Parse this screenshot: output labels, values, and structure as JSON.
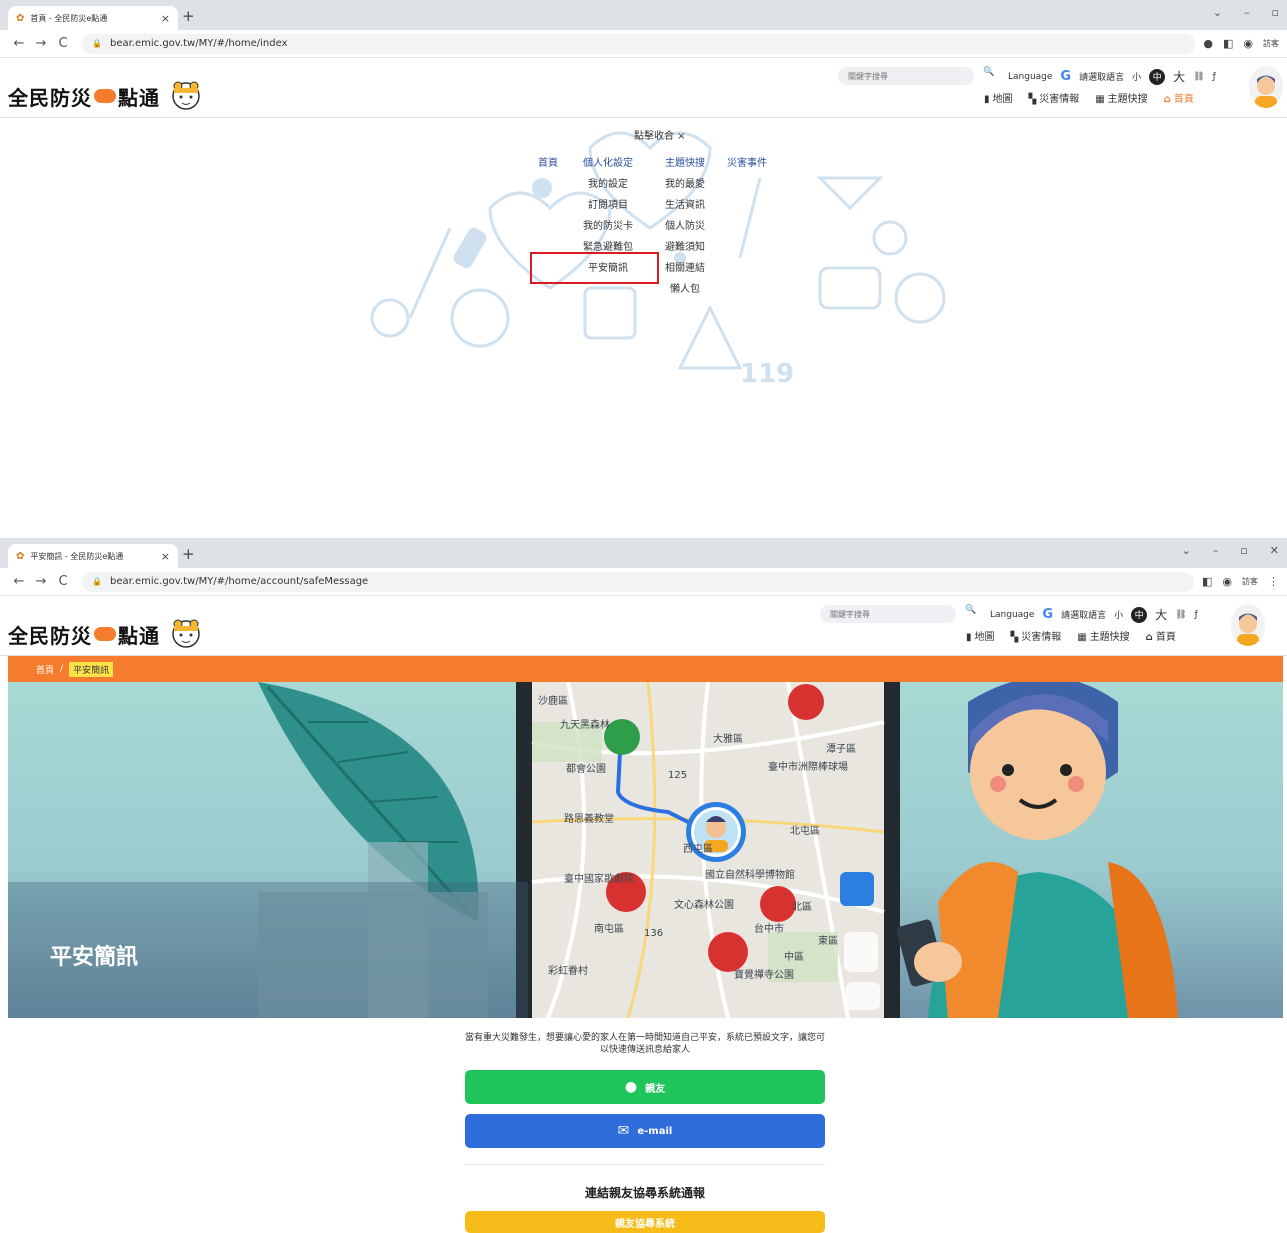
{
  "window1": {
    "tab_title": "首頁 - 全民防災e點通",
    "url": "bear.emic.gov.tw/MY/#/home/index"
  },
  "window2": {
    "tab_title": "平安簡訊 - 全民防災e點通",
    "url": "bear.emic.gov.tw/MY/#/home/account/safeMessage"
  },
  "browser": {
    "new_tab": "+",
    "close_tab": "×",
    "guest": "訪客",
    "back": "←",
    "forward": "→",
    "reload": "C"
  },
  "site": {
    "logo_left": "全民防災",
    "logo_right": "點通",
    "search_placeholder": "關鍵字搜尋",
    "language": "Language",
    "google_g": "G",
    "translate": "請選取語言",
    "font_small": "小",
    "font_mid": "中",
    "font_large": "大",
    "nav": [
      {
        "icon": "▮",
        "label": "地圖"
      },
      {
        "icon": "▚",
        "label": "災害情報"
      },
      {
        "icon": "▦",
        "label": "主題快搜"
      },
      {
        "icon": "⌂",
        "label": "首頁"
      }
    ]
  },
  "sitemap": {
    "close": "點擊收合 ×",
    "col1": [
      "首頁"
    ],
    "col2": [
      "個人化設定",
      "我的設定",
      "訂閱項目",
      "我的防災卡",
      "緊急避難包",
      "平安簡訊"
    ],
    "col3": [
      "主題快搜",
      "我的最愛",
      "生活資訊",
      "個人防災",
      "避難須知",
      "相關連結",
      "懶人包"
    ],
    "col4": [
      "災害事件"
    ]
  },
  "page2": {
    "breadcrumb_home": "首頁",
    "breadcrumb_sep": "/",
    "breadcrumb_current": "平安簡訊",
    "banner_title": "平安簡訊",
    "description": "當有重大災難發生，想要讓心愛的家人在第一時間知道自己平安，系統已預設文字，讓您可以快速傳送訊息給家人",
    "btn_line": "親友",
    "btn_email": "e-mail",
    "section_title": "連結親友協尋系統通報",
    "btn_yellow": "親友協尋系統"
  },
  "map_labels": [
    "沙鹿區",
    "九天黑森林",
    "大雅區",
    "潭子區",
    "臺中市洲際棒球場",
    "都會公園",
    "路思義教堂",
    "北屯區",
    "西屯區",
    "臺中國家歌劇院",
    "國立自然科學博物館",
    "文心森林公園",
    "北區",
    "南屯區",
    "台中市",
    "東區",
    "中區",
    "寶覺禪寺公園",
    "彩虹眷村",
    "125",
    "136"
  ]
}
